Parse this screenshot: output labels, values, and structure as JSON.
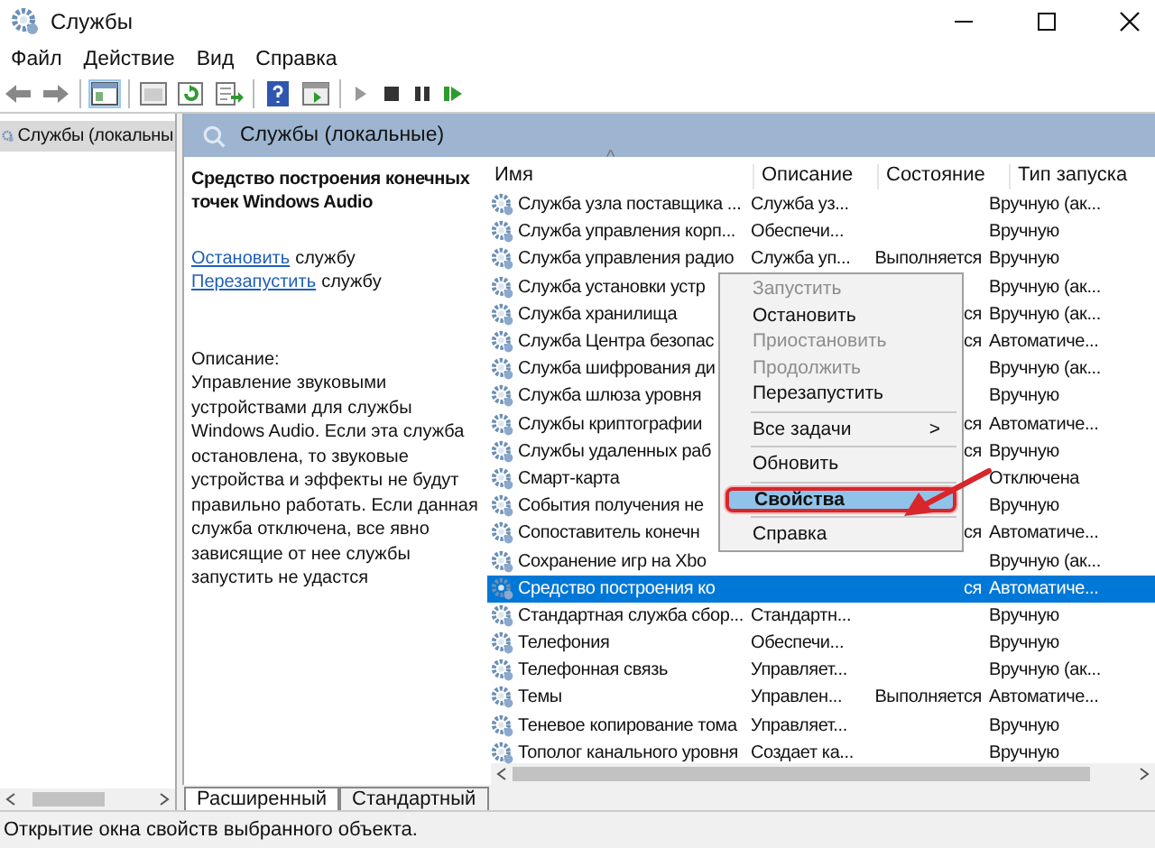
{
  "window": {
    "title": "Службы"
  },
  "menu": [
    "Файл",
    "Действие",
    "Вид",
    "Справка"
  ],
  "tree": {
    "items": [
      {
        "label": "Службы (локальны",
        "selected": true
      }
    ]
  },
  "pane_header": "Службы (локальные)",
  "details": {
    "title": "Средство построения конечных точек Windows Audio",
    "actions": [
      {
        "link": "Остановить",
        "text": "службу"
      },
      {
        "link": "Перезапустить",
        "text": "службу"
      }
    ],
    "description_label": "Описание:",
    "description": "Управление звуковыми устройствами для службы Windows Audio.  Если эта служба остановлена, то звуковые устройства и эффекты не будут правильно работать.  Если данная служба отключена, все явно зависящие от нее службы запустить не удастся"
  },
  "table": {
    "sort_mark": "^",
    "columns": [
      "Имя",
      "Описание",
      "Состояние",
      "Тип запуска"
    ],
    "rows": [
      {
        "name": "Служба узла поставщика ...",
        "description": "Служба уз...",
        "state": "",
        "startup": "Вручную (ак...",
        "selected": false
      },
      {
        "name": "Служба управления корп...",
        "description": "Обеспечи...",
        "state": "",
        "startup": "Вручную",
        "selected": false
      },
      {
        "name": "Служба управления радио",
        "description": "Служба уп...",
        "state": "Выполняется",
        "startup": "Вручную",
        "selected": false
      },
      {
        "name": "Служба установки устр",
        "description": "",
        "state": "",
        "startup": "Вручную (ак...",
        "selected": false
      },
      {
        "name": "Служба хранилища",
        "description": "",
        "state": "ся",
        "startup": "Вручную (ак...",
        "selected": false
      },
      {
        "name": "Служба Центра безопас",
        "description": "",
        "state": "ся",
        "startup": "Автоматиче...",
        "selected": false
      },
      {
        "name": "Служба шифрования ди",
        "description": "",
        "state": "",
        "startup": "Вручную (ак...",
        "selected": false
      },
      {
        "name": "Служба шлюза уровня",
        "description": "",
        "state": "",
        "startup": "Вручную",
        "selected": false
      },
      {
        "name": "Службы криптографии",
        "description": "",
        "state": "ся",
        "startup": "Автоматиче...",
        "selected": false
      },
      {
        "name": "Службы удаленных раб",
        "description": "",
        "state": "ся",
        "startup": "Вручную",
        "selected": false
      },
      {
        "name": "Смарт-карта",
        "description": "",
        "state": "",
        "startup": "Отключена",
        "selected": false
      },
      {
        "name": "События получения не",
        "description": "",
        "state": "",
        "startup": "Вручную",
        "selected": false
      },
      {
        "name": "Сопоставитель конечн",
        "description": "",
        "state": "ся",
        "startup": "Автоматиче...",
        "selected": false
      },
      {
        "name": "Сохранение игр на Xbo",
        "description": "",
        "state": "",
        "startup": "Вручную (ак...",
        "selected": false
      },
      {
        "name": "Средство построения ко",
        "description": "",
        "state": "ся",
        "startup": "Автоматиче...",
        "selected": true
      },
      {
        "name": "Стандартная служба сбор...",
        "description": "Стандартн...",
        "state": "",
        "startup": "Вручную",
        "selected": false
      },
      {
        "name": "Телефония",
        "description": "Обеспечи...",
        "state": "",
        "startup": "Вручную",
        "selected": false
      },
      {
        "name": "Телефонная связь",
        "description": "Управляет...",
        "state": "",
        "startup": "Вручную (ак...",
        "selected": false
      },
      {
        "name": "Темы",
        "description": "Управлен...",
        "state": "Выполняется",
        "startup": "Автоматиче...",
        "selected": false
      },
      {
        "name": "Теневое копирование тома",
        "description": "Управляет...",
        "state": "",
        "startup": "Вручную",
        "selected": false
      },
      {
        "name": "Тополог канального уровня",
        "description": "Создает ка...",
        "state": "",
        "startup": "Вручную",
        "selected": false
      }
    ]
  },
  "context_menu": {
    "items": [
      {
        "kind": "item",
        "label": "Запустить",
        "disabled": true,
        "highlighted": false
      },
      {
        "kind": "item",
        "label": "Остановить",
        "disabled": false,
        "highlighted": false
      },
      {
        "kind": "item",
        "label": "Приостановить",
        "disabled": true,
        "highlighted": false
      },
      {
        "kind": "item",
        "label": "Продолжить",
        "disabled": true,
        "highlighted": false
      },
      {
        "kind": "item",
        "label": "Перезапустить",
        "disabled": false,
        "highlighted": false
      },
      {
        "kind": "separator"
      },
      {
        "kind": "submenu",
        "label": "Все задачи",
        "arrow": ">",
        "disabled": false,
        "highlighted": false
      },
      {
        "kind": "separator"
      },
      {
        "kind": "item",
        "label": "Обновить",
        "disabled": false,
        "highlighted": false
      },
      {
        "kind": "separator"
      },
      {
        "kind": "item",
        "label": "Свойства",
        "disabled": false,
        "highlighted": true
      },
      {
        "kind": "separator"
      },
      {
        "kind": "item",
        "label": "Справка",
        "disabled": false,
        "highlighted": false
      }
    ]
  },
  "view_tabs": [
    {
      "label": "Расширенный",
      "selected": true
    },
    {
      "label": "Стандартный",
      "selected": false
    }
  ],
  "status_bar": "Открытие окна свойств выбранного объекта."
}
